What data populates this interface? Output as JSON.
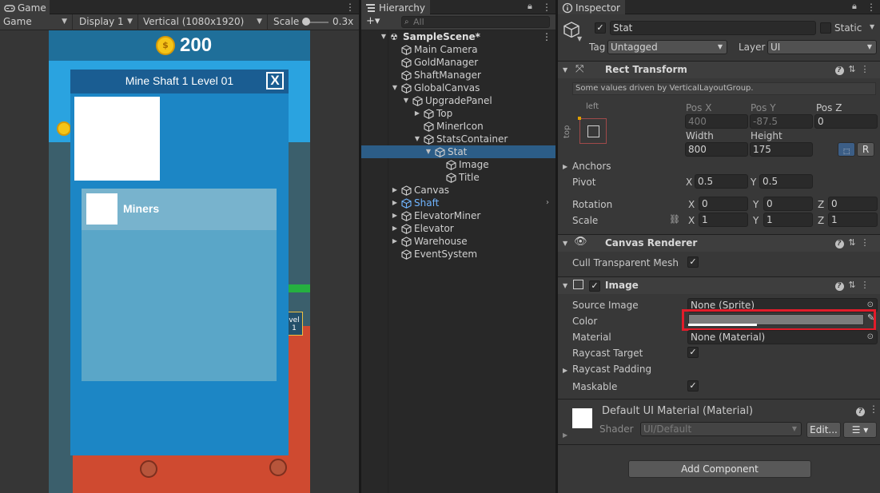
{
  "game": {
    "tab_label": "Game",
    "toolbar": {
      "mode": "Game",
      "display": "Display 1",
      "resolution": "Vertical (1080x1920)",
      "scale_label": "Scale",
      "scale_value": "0.3x"
    },
    "gold_amount": "200",
    "coin_symbol": "$",
    "upgrade_panel": {
      "title": "Mine Shaft 1 Level 01",
      "close_label": "X",
      "stat_title": "Miners"
    },
    "level_tag": "vel\n1"
  },
  "hierarchy": {
    "tab_label": "Hierarchy",
    "add_label": "+▾",
    "search_placeholder": "All",
    "items": [
      {
        "label": "SampleScene*",
        "depth": 0,
        "expanded": true,
        "type": "scene"
      },
      {
        "label": "Main Camera",
        "depth": 1,
        "type": "object"
      },
      {
        "label": "GoldManager",
        "depth": 1,
        "type": "object"
      },
      {
        "label": "ShaftManager",
        "depth": 1,
        "type": "object"
      },
      {
        "label": "GlobalCanvas",
        "depth": 1,
        "expanded": true,
        "type": "object"
      },
      {
        "label": "UpgradePanel",
        "depth": 2,
        "expanded": true,
        "type": "object"
      },
      {
        "label": "Top",
        "depth": 3,
        "collapsed": true,
        "type": "object"
      },
      {
        "label": "MinerIcon",
        "depth": 3,
        "type": "object"
      },
      {
        "label": "StatsContainer",
        "depth": 3,
        "expanded": true,
        "type": "object"
      },
      {
        "label": "Stat",
        "depth": 4,
        "expanded": true,
        "type": "object",
        "selected": true
      },
      {
        "label": "Image",
        "depth": 5,
        "type": "object"
      },
      {
        "label": "Title",
        "depth": 5,
        "type": "object"
      },
      {
        "label": "Canvas",
        "depth": 1,
        "collapsed": true,
        "type": "object"
      },
      {
        "label": "Shaft",
        "depth": 1,
        "collapsed": true,
        "type": "prefab"
      },
      {
        "label": "ElevatorMiner",
        "depth": 1,
        "collapsed": true,
        "type": "object"
      },
      {
        "label": "Elevator",
        "depth": 1,
        "collapsed": true,
        "type": "object"
      },
      {
        "label": "Warehouse",
        "depth": 1,
        "collapsed": true,
        "type": "object"
      },
      {
        "label": "EventSystem",
        "depth": 1,
        "type": "object"
      }
    ]
  },
  "inspector": {
    "tab_label": "Inspector",
    "object_name": "Stat",
    "static_label": "Static",
    "tag_label": "Tag",
    "tag_value": "Untagged",
    "layer_label": "Layer",
    "layer_value": "UI",
    "rect_transform": {
      "title": "Rect Transform",
      "info": "Some values driven by VerticalLayoutGroup.",
      "anchor_h": "left",
      "anchor_v": "top",
      "posx_label": "Pos X",
      "posy_label": "Pos Y",
      "posz_label": "Pos Z",
      "posx": "400",
      "posy": "-87.5",
      "posz": "0",
      "width_label": "Width",
      "height_label": "Height",
      "width": "800",
      "height": "175",
      "r_button": "R",
      "anchors_label": "Anchors",
      "pivot_label": "Pivot",
      "pivot_x": "0.5",
      "pivot_y": "0.5",
      "rotation_label": "Rotation",
      "rot_x": "0",
      "rot_y": "0",
      "rot_z": "0",
      "scale_label": "Scale",
      "scale_x": "1",
      "scale_y": "1",
      "scale_z": "1",
      "x": "X",
      "y": "Y",
      "z": "Z"
    },
    "canvas_renderer": {
      "title": "Canvas Renderer",
      "cull_label": "Cull Transparent Mesh"
    },
    "image": {
      "title": "Image",
      "source_label": "Source Image",
      "source_value": "None (Sprite)",
      "color_label": "Color",
      "color_value": "#7c7c7c",
      "material_label": "Material",
      "material_value": "None (Material)",
      "raycast_target_label": "Raycast Target",
      "raycast_padding_label": "Raycast Padding",
      "maskable_label": "Maskable"
    },
    "material_asset": {
      "title": "Default UI Material (Material)",
      "shader_label": "Shader",
      "shader_value": "UI/Default",
      "edit_label": "Edit..."
    },
    "add_component": "Add Component",
    "checkmark": "✓"
  }
}
